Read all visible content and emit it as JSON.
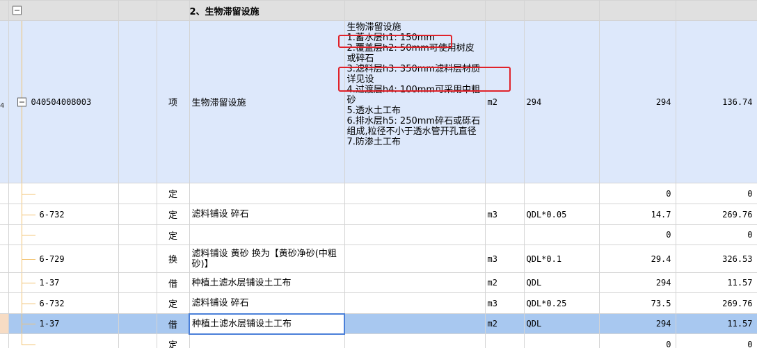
{
  "group": {
    "title": "2、生物滞留设施"
  },
  "main_row": {
    "code": "040504008003",
    "type": "项",
    "name": "生物滞留设施",
    "feature_lines": [
      "生物滞留设施",
      "1.蓄水层h1: 150mm",
      "2.覆盖层h2: 50mm可使用树皮或碎石",
      "3.滤料层h3: 350mm滤料层材质详见设",
      "4.过渡层h4: 100mm可采用中粗砂",
      "5.透水土工布",
      "6.排水层h5: 250mm碎石或砾石组成,粒径不小于透水管开孔直径",
      "7.防渗土工布"
    ],
    "unit": "m2",
    "expr": "294",
    "qty": "294",
    "price": "136.74"
  },
  "rows": [
    {
      "code": "",
      "type": "定",
      "name": "",
      "unit": "",
      "expr": "",
      "qty": "0",
      "price": "0"
    },
    {
      "code": "6-732",
      "type": "定",
      "name": "滤料铺设 碎石",
      "unit": "m3",
      "expr": "QDL*0.05",
      "qty": "14.7",
      "price": "269.76"
    },
    {
      "code": "",
      "type": "定",
      "name": "",
      "unit": "",
      "expr": "",
      "qty": "0",
      "price": "0"
    },
    {
      "code": "6-729",
      "type": "换",
      "name": "滤料铺设 黄砂  换为【黄砂净砂(中粗砂)】",
      "unit": "m3",
      "expr": "QDL*0.1",
      "qty": "29.4",
      "price": "326.53"
    },
    {
      "code": "1-37",
      "type": "借",
      "name": "种植土滤水层铺设土工布",
      "unit": "m2",
      "expr": "QDL",
      "qty": "294",
      "price": "11.57"
    },
    {
      "code": "6-732",
      "type": "定",
      "name": "滤料铺设 碎石",
      "unit": "m3",
      "expr": "QDL*0.25",
      "qty": "73.5",
      "price": "269.76"
    },
    {
      "code": "1-37",
      "type": "借",
      "name": "种植土滤水层铺设土工布",
      "unit": "m2",
      "expr": "QDL",
      "qty": "294",
      "price": "11.57"
    },
    {
      "code": "",
      "type": "定",
      "name": "",
      "unit": "",
      "expr": "",
      "qty": "0",
      "price": "0"
    }
  ],
  "row_marker": "4",
  "colors": {
    "header_bg": "#e0e0e0",
    "main_bg": "#dde8fb",
    "selected_bg": "#a8c8f0",
    "annotation": "#e0222a",
    "tree_line": "#f2c270"
  }
}
